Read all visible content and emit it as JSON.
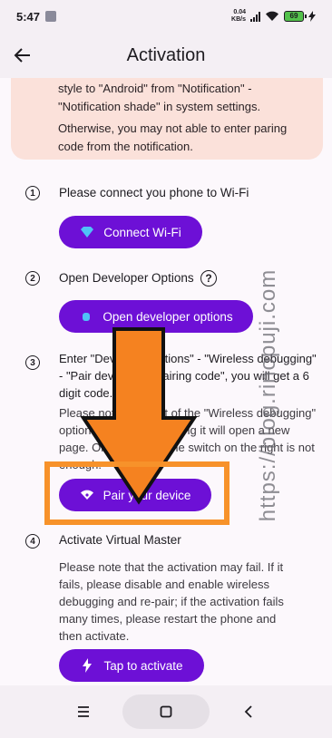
{
  "status_bar": {
    "time": "5:47",
    "net_speed_value": "0.04",
    "net_speed_unit": "KB/s",
    "battery": "69"
  },
  "app_bar": {
    "title": "Activation",
    "back_icon": "back-arrow-icon"
  },
  "warning": {
    "line1": "style to \"Android\" from \"Notification\" - \"Notification shade\" in system settings.",
    "line2": "Otherwise, you may not able to enter paring code from the notification."
  },
  "steps": [
    {
      "number": "1",
      "title": "Please connect you phone to Wi-Fi",
      "button_label": "Connect Wi-Fi",
      "button_icon": "diamond-wifi-icon"
    },
    {
      "number": "2",
      "title": "Open Developer Options",
      "help": "?",
      "button_label": "Open developer options",
      "button_icon": "android-icon"
    },
    {
      "number": "3",
      "title": "Enter \"Developer options\" - \"Wireless debugging\" - \"Pair device with pairing code\", you will get a 6 digit code.",
      "desc": "Please note that part of the \"Wireless debugging\" option is clickable, tapping it will open a new page. Only turing on the switch on the right is not enough.",
      "button_label": "Pair your device",
      "button_icon": "wifi-icon"
    },
    {
      "number": "4",
      "title": "Activate Virtual Master",
      "desc": "Please note that the activation may fail. If it fails, please disable and enable wireless debugging and re-pair; if the activation fails many times, please restart the phone and then activate.",
      "button_label": "Tap to activate",
      "button_icon": "lightning-icon"
    }
  ],
  "watermark": "https://blog.rinopuji.com",
  "nav": {
    "menu_icon": "menu-icon",
    "home_icon": "home-icon",
    "back_icon": "back-chevron-icon"
  },
  "colors": {
    "accent": "#6d10d6",
    "warning_bg": "#fbe1da",
    "highlight": "#f7922a",
    "arrow": "#f58220"
  }
}
